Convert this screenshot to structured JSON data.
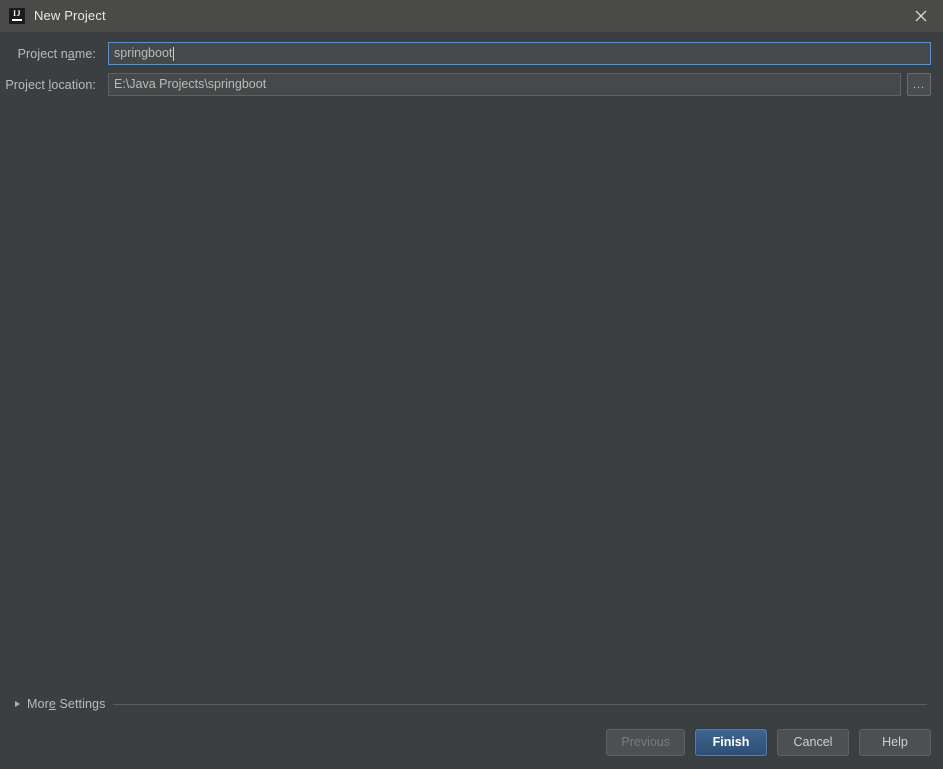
{
  "window": {
    "title": "New Project",
    "app_icon": "intellij-idea-icon",
    "icon_text": "IJ",
    "close_icon": "close-icon"
  },
  "form": {
    "project_name": {
      "label_before": "Project n",
      "label_mnemonic": "a",
      "label_after": "me:",
      "label_full": "Project name:",
      "value": "springboot",
      "focused": true
    },
    "project_location": {
      "label_before": "Project ",
      "label_mnemonic": "l",
      "label_after": "ocation:",
      "label_full": "Project location:",
      "value": "E:\\Java Projects\\springboot",
      "browse_label": "...",
      "browse_icon": "ellipsis-icon"
    }
  },
  "more_settings": {
    "label_before": "Mor",
    "label_mnemonic": "e",
    "label_after": " Settings",
    "label_full": "More Settings",
    "expanded": false,
    "disclosure_icon": "chevron-right-icon"
  },
  "footer": {
    "previous_label": "Previous",
    "previous_disabled": true,
    "finish_label": "Finish",
    "finish_is_default": true,
    "cancel_label": "Cancel",
    "help_label": "Help"
  },
  "colors": {
    "titlebar_bg": "#4a4a48",
    "dialog_bg": "#3c3f41",
    "field_bg": "#45494a",
    "focus_border": "#5c90c8",
    "default_button_bg": "#365880",
    "text": "#bbbbbb"
  }
}
